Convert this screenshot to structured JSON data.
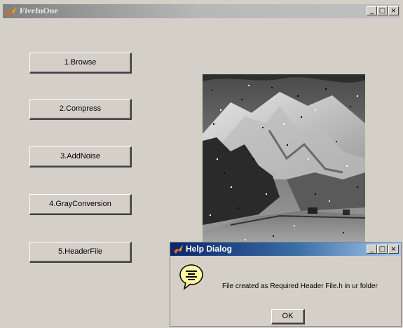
{
  "window": {
    "title": "FiveInOne",
    "controls": {
      "minimize": "_",
      "maximize": "□",
      "close": "×"
    }
  },
  "buttons": [
    {
      "label": "1.Browse"
    },
    {
      "label": "2.Compress"
    },
    {
      "label": "3.AddNoise"
    },
    {
      "label": "4.GrayConversion"
    },
    {
      "label": "5.HeaderFile"
    }
  ],
  "image_panel": {
    "icon": "grayscale-mountain-road-photo-with-noise"
  },
  "help_dialog": {
    "title": "Help Dialog",
    "controls": {
      "minimize": "_",
      "maximize": "□",
      "close": "×"
    },
    "message": "File  created as Required Header File.h in ur folder",
    "ok_label": "OK",
    "icon": "help-speech-bubble-icon"
  },
  "colors": {
    "app_titlebar": "#a0a0a0",
    "dialog_titlebar": "#0a246a",
    "face": "#d4d0c8"
  }
}
